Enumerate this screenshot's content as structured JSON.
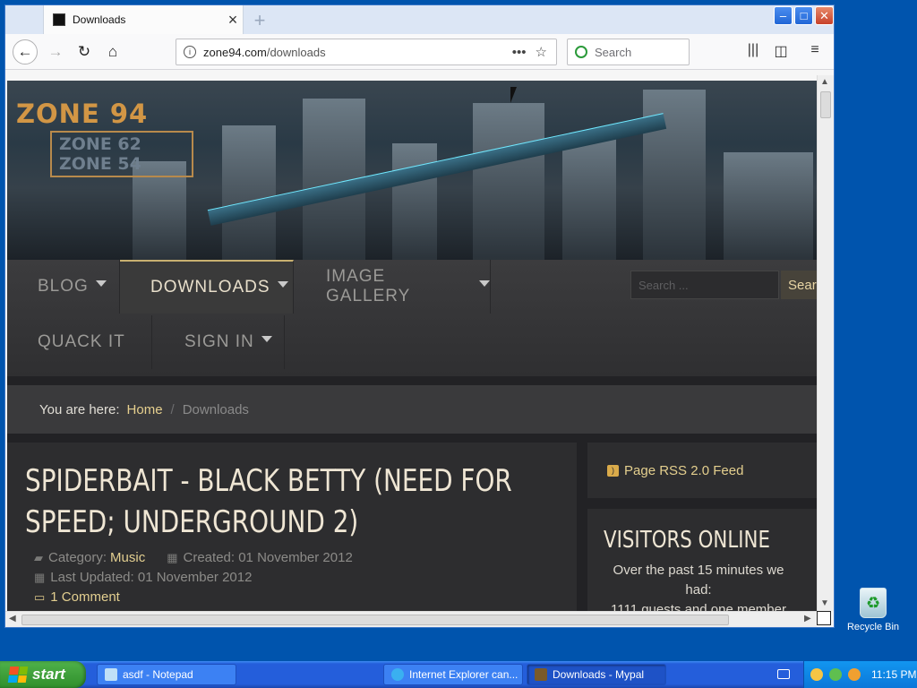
{
  "desktop": {
    "recycle_label": "Recycle Bin"
  },
  "browser": {
    "tab": {
      "title": "Downloads"
    },
    "url": {
      "host": "zone94.com",
      "path": "/downloads"
    },
    "search_placeholder": "Search"
  },
  "site": {
    "logo": {
      "main": "ZONE 94",
      "sub1": "ZONE 62",
      "sub2": "ZONE 54"
    },
    "menu": {
      "blog": "BLOG",
      "downloads": "DOWNLOADS",
      "gallery": "IMAGE GALLERY",
      "quack": "QUACK IT",
      "signin": "SIGN IN"
    },
    "search": {
      "placeholder": "Search ...",
      "button": "Search"
    },
    "breadcrumb": {
      "prefix": "You are here:",
      "home": "Home",
      "sep": "/",
      "current": "Downloads"
    },
    "article": {
      "title_line1": "SPIDERBAIT - BLACK BETTY (NEED FOR",
      "title_line2": "SPEED; UNDERGROUND 2)",
      "category_label": "Category:",
      "category": "Music",
      "created": "Created: 01 November 2012",
      "updated": "Last Updated: 01 November 2012",
      "comments": "1 Comment"
    },
    "sidebar": {
      "rss": "Page RSS 2.0 Feed",
      "visitors_title": "VISITORS ONLINE",
      "visitors_line1": "Over the past 15 minutes we",
      "visitors_line2": "had:",
      "visitors_line3": "1111 guests and one member"
    }
  },
  "taskbar": {
    "start": "start",
    "tasks": [
      "asdf - Notepad",
      "Internet Explorer can...",
      "Downloads - Mypal"
    ],
    "clock": "11:15 PM"
  },
  "colors": {
    "accent_gold": "#e3cf90",
    "taskbar_blue": "#245edb",
    "start_green": "#3a9a35"
  }
}
